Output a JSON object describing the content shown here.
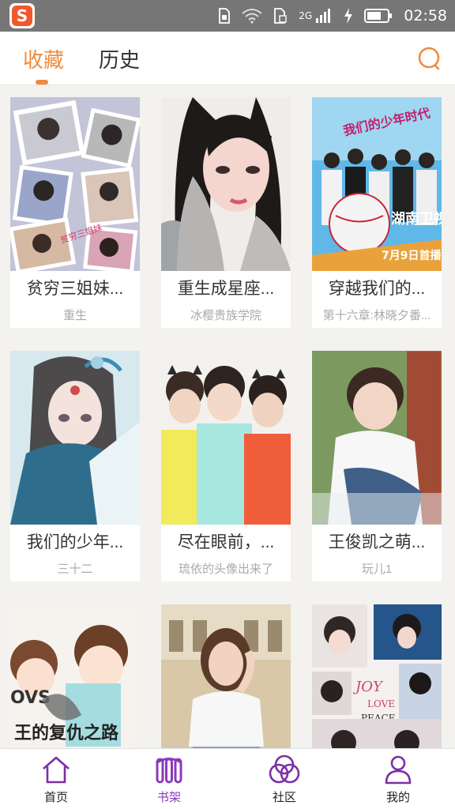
{
  "status_bar": {
    "network": "2G",
    "time": "02:58"
  },
  "header": {
    "tabs": [
      {
        "label": "收藏",
        "active": true
      },
      {
        "label": "历史",
        "active": false
      }
    ],
    "search_icon": "search-icon",
    "accent_color": "#f08a3e"
  },
  "books": [
    {
      "title": "贫穷三姐妹...",
      "subtitle": "重生"
    },
    {
      "title": "重生成星座...",
      "subtitle": "冰樱贵族学院"
    },
    {
      "title": "穿越我们的...",
      "subtitle": "第十六章:林晓夕番..."
    },
    {
      "title": "我们的少年...",
      "subtitle": "三十二"
    },
    {
      "title": "尽在眼前，...",
      "subtitle": "琉依的头像出来了"
    },
    {
      "title": "王俊凯之萌...",
      "subtitle": "玩儿1"
    },
    {
      "title": "",
      "subtitle": ""
    },
    {
      "title": "",
      "subtitle": ""
    },
    {
      "title": "",
      "subtitle": ""
    }
  ],
  "bottom_nav": {
    "items": [
      {
        "label": "首页",
        "icon": "home-icon",
        "active": false
      },
      {
        "label": "书架",
        "icon": "bookshelf-icon",
        "active": true
      },
      {
        "label": "社区",
        "icon": "community-icon",
        "active": false
      },
      {
        "label": "我的",
        "icon": "profile-icon",
        "active": false
      }
    ],
    "active_color": "#8a3ab9"
  }
}
